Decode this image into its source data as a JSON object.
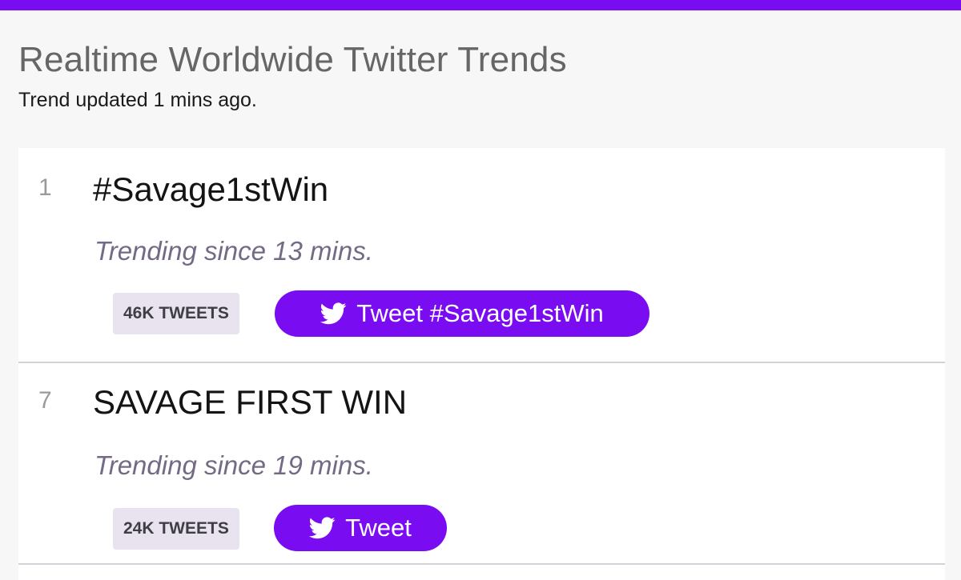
{
  "header": {
    "accent_color": "#7a0cf2",
    "title": "Realtime Worldwide Twitter Trends",
    "updated": "Trend updated 1 mins ago."
  },
  "trends": [
    {
      "rank": "1",
      "name": "#Savage1stWin",
      "since": "Trending since 13 mins.",
      "tweet_count": "46K TWEETS",
      "button_label": "Tweet #Savage1stWin",
      "button_icon": "twitter-bird-icon"
    },
    {
      "rank": "7",
      "name": "SAVAGE FIRST WIN",
      "since": "Trending since 19 mins.",
      "tweet_count": "24K TWEETS",
      "button_label": "Tweet",
      "button_icon": "twitter-bird-icon"
    }
  ]
}
